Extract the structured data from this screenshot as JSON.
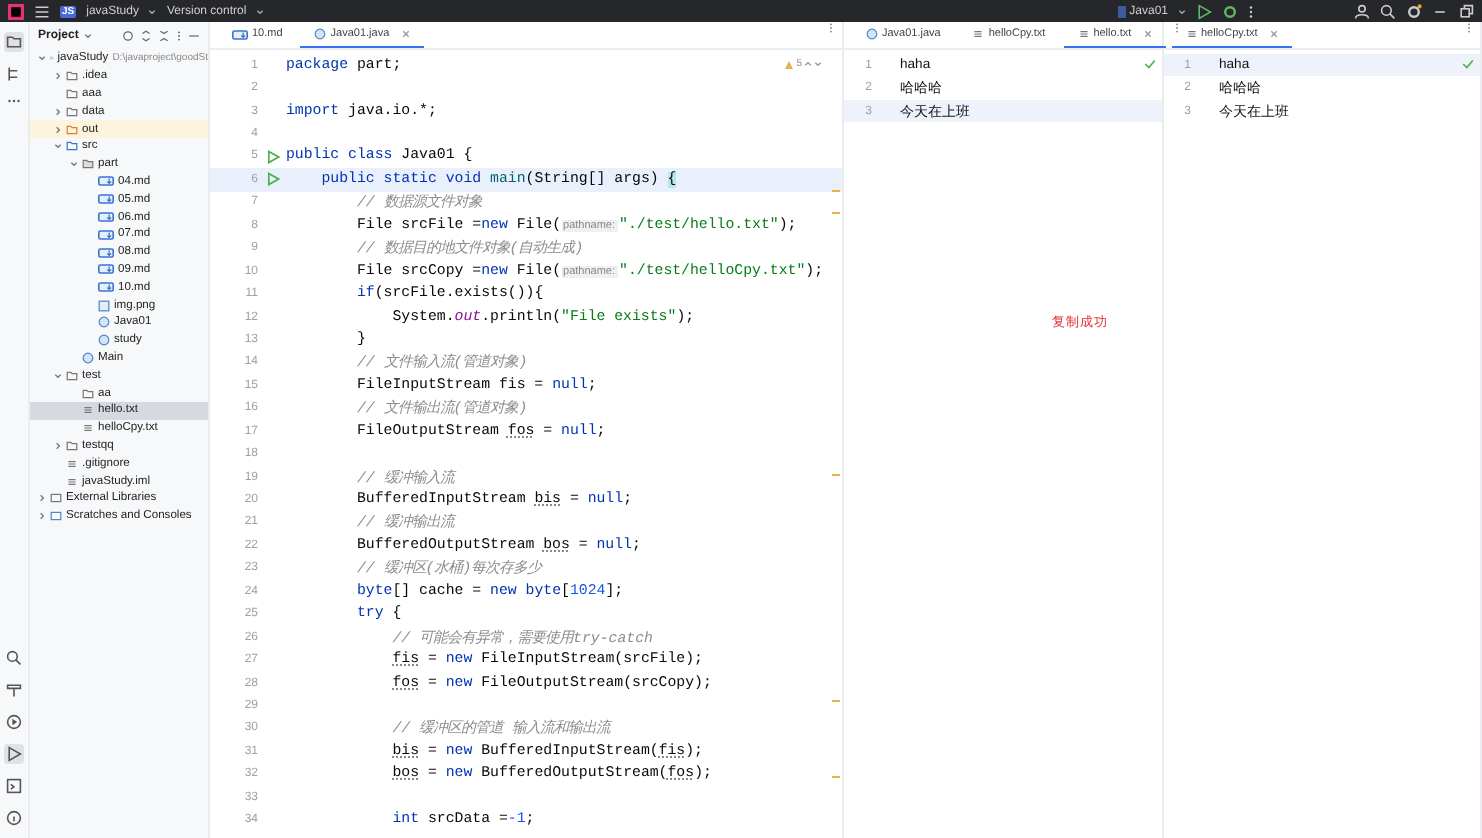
{
  "title_bar": {
    "project": "javaStudy",
    "project_badge": "JS",
    "vcs": "Version control",
    "run_config": "Java01"
  },
  "project_panel": {
    "title": "Project",
    "tree": [
      {
        "label": "javaStudy",
        "path": "D:\\javaproject\\goodSt",
        "kind": "module",
        "expanded": true,
        "selected": false,
        "children": [
          {
            "label": ".idea",
            "kind": "folder",
            "expanded": false,
            "selected": false
          },
          {
            "label": "aaa",
            "kind": "folder",
            "selected": false
          },
          {
            "label": "data",
            "kind": "folder",
            "expanded": false,
            "selected": false
          },
          {
            "label": "out",
            "kind": "excluded",
            "expanded": false,
            "selected": false
          },
          {
            "label": "src",
            "kind": "source",
            "expanded": true,
            "selected": false,
            "children": [
              {
                "label": "part",
                "kind": "package",
                "expanded": true,
                "selected": false,
                "children": [
                  {
                    "label": "04.md",
                    "kind": "md",
                    "selected": false
                  },
                  {
                    "label": "05.md",
                    "kind": "md",
                    "selected": false
                  },
                  {
                    "label": "06.md",
                    "kind": "md",
                    "selected": false
                  },
                  {
                    "label": "07.md",
                    "kind": "md",
                    "selected": false
                  },
                  {
                    "label": "08.md",
                    "kind": "md",
                    "selected": false
                  },
                  {
                    "label": "09.md",
                    "kind": "md",
                    "selected": false
                  },
                  {
                    "label": "10.md",
                    "kind": "md",
                    "selected": false
                  },
                  {
                    "label": "img.png",
                    "kind": "image",
                    "selected": false
                  },
                  {
                    "label": "Java01",
                    "kind": "java",
                    "selected": false
                  },
                  {
                    "label": "study",
                    "kind": "java",
                    "selected": false
                  }
                ]
              },
              {
                "label": "Main",
                "kind": "java",
                "selected": false
              }
            ]
          },
          {
            "label": "test",
            "kind": "folder",
            "expanded": true,
            "selected": false,
            "children": [
              {
                "label": "aa",
                "kind": "folder",
                "selected": false
              },
              {
                "label": "hello.txt",
                "kind": "txt",
                "selected": true
              },
              {
                "label": "helloCpy.txt",
                "kind": "txt",
                "selected": false
              }
            ]
          },
          {
            "label": "testqq",
            "kind": "folder",
            "expanded": false,
            "selected": false
          },
          {
            "label": ".gitignore",
            "kind": "txt",
            "selected": false
          },
          {
            "label": "javaStudy.iml",
            "kind": "txt",
            "selected": false
          }
        ]
      },
      {
        "label": "External Libraries",
        "kind": "library",
        "expanded": false,
        "selected": false
      },
      {
        "label": "Scratches and Consoles",
        "kind": "scratch",
        "expanded": false,
        "selected": false
      }
    ]
  },
  "editor": {
    "tabs": [
      {
        "label": "10.md",
        "kind": "md",
        "selected": false
      },
      {
        "label": "Java01.java",
        "kind": "java",
        "selected": true
      }
    ],
    "warnings": "5",
    "lines": [
      {
        "n": "1",
        "tokens": [
          {
            "t": "package ",
            "kind": "kw"
          },
          {
            "t": "part;",
            "kind": "plain"
          }
        ]
      },
      {
        "n": "2"
      },
      {
        "n": "3",
        "tokens": [
          {
            "t": "import ",
            "kind": "kw"
          },
          {
            "t": "java.io.*;",
            "kind": "plain"
          }
        ]
      },
      {
        "n": "4"
      },
      {
        "n": "5",
        "run": true,
        "tokens": [
          {
            "t": "public class ",
            "kind": "kw"
          },
          {
            "t": "Java01 {",
            "kind": "plain"
          }
        ]
      },
      {
        "n": "6",
        "run": true,
        "current": true,
        "tokens": [
          {
            "t": "    public static void ",
            "kind": "kw"
          },
          {
            "t": "main",
            "kind": "fn"
          },
          {
            "t": "(String[] args) ",
            "kind": "plain"
          },
          {
            "t": "{",
            "kind": "match"
          }
        ]
      },
      {
        "n": "7",
        "tokens": [
          {
            "t": "        // 数据源文件对象",
            "kind": "cmt"
          }
        ]
      },
      {
        "n": "8",
        "tokens": [
          {
            "t": "        File srcFile =",
            "kind": "plain"
          },
          {
            "t": "new ",
            "kind": "kw"
          },
          {
            "t": "File(",
            "kind": "plain"
          },
          {
            "t": "pathname:",
            "kind": "hint"
          },
          {
            "t": "\"./test/hello.txt\"",
            "kind": "str"
          },
          {
            "t": ");",
            "kind": "plain"
          }
        ]
      },
      {
        "n": "9",
        "tokens": [
          {
            "t": "        // 数据目的地文件对象(自动生成)",
            "kind": "cmt"
          }
        ]
      },
      {
        "n": "10",
        "tokens": [
          {
            "t": "        File srcCopy =",
            "kind": "plain"
          },
          {
            "t": "new ",
            "kind": "kw"
          },
          {
            "t": "File(",
            "kind": "plain"
          },
          {
            "t": "pathname:",
            "kind": "hint"
          },
          {
            "t": "\"./test/helloCpy.txt\"",
            "kind": "str"
          },
          {
            "t": ");",
            "kind": "plain"
          }
        ]
      },
      {
        "n": "11",
        "tokens": [
          {
            "t": "        if",
            "kind": "kw"
          },
          {
            "t": "(srcFile.exists()){",
            "kind": "plain"
          }
        ]
      },
      {
        "n": "12",
        "tokens": [
          {
            "t": "            System.",
            "kind": "plain"
          },
          {
            "t": "out",
            "kind": "fld"
          },
          {
            "t": ".println(",
            "kind": "plain"
          },
          {
            "t": "\"File exists\"",
            "kind": "str"
          },
          {
            "t": ");",
            "kind": "plain"
          }
        ]
      },
      {
        "n": "13",
        "tokens": [
          {
            "t": "        }",
            "kind": "plain"
          }
        ]
      },
      {
        "n": "14",
        "tokens": [
          {
            "t": "        // 文件输入流(管道对象)",
            "kind": "cmt"
          }
        ]
      },
      {
        "n": "15",
        "tokens": [
          {
            "t": "        FileInputStream fis = ",
            "kind": "plain"
          },
          {
            "t": "null",
            "kind": "kw"
          },
          {
            "t": ";",
            "kind": "plain"
          }
        ]
      },
      {
        "n": "16",
        "tokens": [
          {
            "t": "        // 文件输出流(管道对象)",
            "kind": "cmt"
          }
        ]
      },
      {
        "n": "17",
        "tokens": [
          {
            "t": "        FileOutputStream ",
            "kind": "plain"
          },
          {
            "t": "fos",
            "kind": "var"
          },
          {
            "t": " = ",
            "kind": "plain"
          },
          {
            "t": "null",
            "kind": "kw"
          },
          {
            "t": ";",
            "kind": "plain"
          }
        ]
      },
      {
        "n": "18"
      },
      {
        "n": "19",
        "tokens": [
          {
            "t": "        // 缓冲输入流",
            "kind": "cmt"
          }
        ]
      },
      {
        "n": "20",
        "tokens": [
          {
            "t": "        BufferedInputStream ",
            "kind": "plain"
          },
          {
            "t": "bis",
            "kind": "var"
          },
          {
            "t": " = ",
            "kind": "plain"
          },
          {
            "t": "null",
            "kind": "kw"
          },
          {
            "t": ";",
            "kind": "plain"
          }
        ]
      },
      {
        "n": "21",
        "tokens": [
          {
            "t": "        // 缓冲输出流",
            "kind": "cmt"
          }
        ]
      },
      {
        "n": "22",
        "tokens": [
          {
            "t": "        BufferedOutputStream ",
            "kind": "plain"
          },
          {
            "t": "bos",
            "kind": "var"
          },
          {
            "t": " = ",
            "kind": "plain"
          },
          {
            "t": "null",
            "kind": "kw"
          },
          {
            "t": ";",
            "kind": "plain"
          }
        ]
      },
      {
        "n": "23",
        "tokens": [
          {
            "t": "        // 缓冲区(水桶)每次存多少",
            "kind": "cmt"
          }
        ]
      },
      {
        "n": "24",
        "tokens": [
          {
            "t": "        byte",
            "kind": "kw"
          },
          {
            "t": "[] cache = ",
            "kind": "plain"
          },
          {
            "t": "new byte",
            "kind": "kw"
          },
          {
            "t": "[",
            "kind": "plain"
          },
          {
            "t": "1024",
            "kind": "num"
          },
          {
            "t": "];",
            "kind": "plain"
          }
        ]
      },
      {
        "n": "25",
        "tokens": [
          {
            "t": "        try",
            "kind": "kw"
          },
          {
            "t": " {",
            "kind": "plain"
          }
        ]
      },
      {
        "n": "26",
        "tokens": [
          {
            "t": "            // 可能会有异常，需要使用try-catch",
            "kind": "cmt"
          }
        ]
      },
      {
        "n": "27",
        "tokens": [
          {
            "t": "            fis",
            "kind": "var"
          },
          {
            "t": " = ",
            "kind": "plain"
          },
          {
            "t": "new ",
            "kind": "kw"
          },
          {
            "t": "FileInputStream(srcFile);",
            "kind": "plain"
          }
        ]
      },
      {
        "n": "28",
        "tokens": [
          {
            "t": "            fos",
            "kind": "var"
          },
          {
            "t": " = ",
            "kind": "plain"
          },
          {
            "t": "new ",
            "kind": "kw"
          },
          {
            "t": "FileOutputStream(srcCopy);",
            "kind": "plain"
          }
        ]
      },
      {
        "n": "29"
      },
      {
        "n": "30",
        "tokens": [
          {
            "t": "            // 缓冲区的管道 输入流和输出流",
            "kind": "cmt"
          }
        ]
      },
      {
        "n": "31",
        "tokens": [
          {
            "t": "            bis",
            "kind": "var"
          },
          {
            "t": " = ",
            "kind": "plain"
          },
          {
            "t": "new ",
            "kind": "kw"
          },
          {
            "t": "BufferedInputStream(",
            "kind": "plain"
          },
          {
            "t": "fis",
            "kind": "var"
          },
          {
            "t": ");",
            "kind": "plain"
          }
        ]
      },
      {
        "n": "32",
        "tokens": [
          {
            "t": "            bos",
            "kind": "var"
          },
          {
            "t": " = ",
            "kind": "plain"
          },
          {
            "t": "new ",
            "kind": "kw"
          },
          {
            "t": "BufferedOutputStream(",
            "kind": "plain"
          },
          {
            "t": "fos",
            "kind": "var"
          },
          {
            "t": ");",
            "kind": "plain"
          }
        ]
      },
      {
        "n": "33"
      },
      {
        "n": "34",
        "tokens": [
          {
            "t": "            int ",
            "kind": "kw"
          },
          {
            "t": "srcData =",
            "kind": "plain"
          },
          {
            "t": "-1",
            "kind": "num"
          },
          {
            "t": ";",
            "kind": "plain"
          }
        ]
      }
    ]
  },
  "split_panes": [
    {
      "tabs": [
        {
          "label": "Java01.java",
          "kind": "java",
          "selected": false
        },
        {
          "label": "helloCpy.txt",
          "kind": "txt",
          "selected": false
        },
        {
          "label": "hello.txt",
          "kind": "txt",
          "selected": true
        }
      ],
      "lines": [
        {
          "n": "1",
          "text": "haha",
          "current": false
        },
        {
          "n": "2",
          "text": "哈哈哈",
          "current": false
        },
        {
          "n": "3",
          "text": "今天在上班",
          "current": true
        }
      ],
      "message": "复制成功"
    },
    {
      "tabs": [
        {
          "label": "helloCpy.txt",
          "kind": "txt",
          "selected": true
        }
      ],
      "lines": [
        {
          "n": "1",
          "text": "haha",
          "current": true
        },
        {
          "n": "2",
          "text": "哈哈哈",
          "current": false
        },
        {
          "n": "3",
          "text": "今天在上班",
          "current": false
        }
      ]
    }
  ]
}
